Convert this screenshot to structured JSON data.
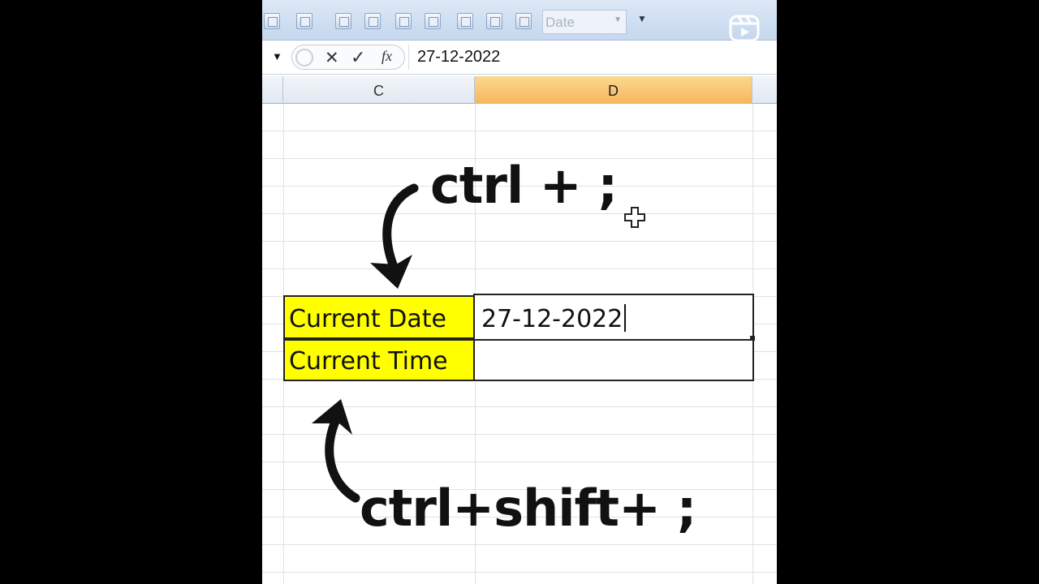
{
  "toolbar": {
    "icons": [
      "table-icon",
      "document-icon",
      "flowchart-icon",
      "hierarchy-icon",
      "form-icon",
      "shapes-icon",
      "folder-icon",
      "page-icon",
      "card-icon"
    ],
    "number_format": "Date",
    "reels_icon": "reels-play-icon"
  },
  "formula_bar": {
    "cancel_icon": "✕",
    "enter_icon": "✓",
    "fx_label": "fx",
    "value": "27-12-2022"
  },
  "columns": [
    "C",
    "D"
  ],
  "cells": {
    "label_date": "Current Date",
    "label_time": "Current Time",
    "value_date": "27-12-2022",
    "value_time": ""
  },
  "annotations": {
    "date_shortcut": "ctrl + ;",
    "time_shortcut": "ctrl+shift+ ;"
  },
  "colors": {
    "label_fill": "#ffff00",
    "active_column": "#f4b75e"
  }
}
